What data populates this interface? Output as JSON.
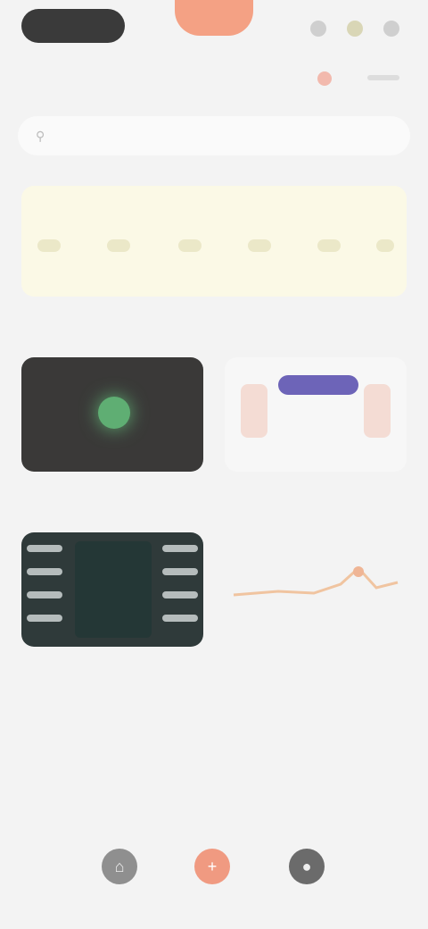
{
  "topbar": {
    "left_pill": "",
    "center_label": ""
  },
  "search": {
    "placeholder": ""
  },
  "banner": {
    "text": ""
  },
  "sections": {
    "left_title": "",
    "right_title": ""
  },
  "cards": [
    {
      "label": ""
    },
    {
      "label": ""
    },
    {
      "label": ""
    },
    {
      "label": ""
    }
  ],
  "nav": {
    "items": [
      {
        "label": "",
        "icon": "home-icon"
      },
      {
        "label": "",
        "icon": "plus-icon"
      },
      {
        "label": "",
        "icon": "profile-icon"
      }
    ]
  },
  "colors": {
    "accent": "#f09a81",
    "banner_bg": "#fbf9e6",
    "dark_card": "#3a3938",
    "chart_line": "#f0c4a0"
  }
}
